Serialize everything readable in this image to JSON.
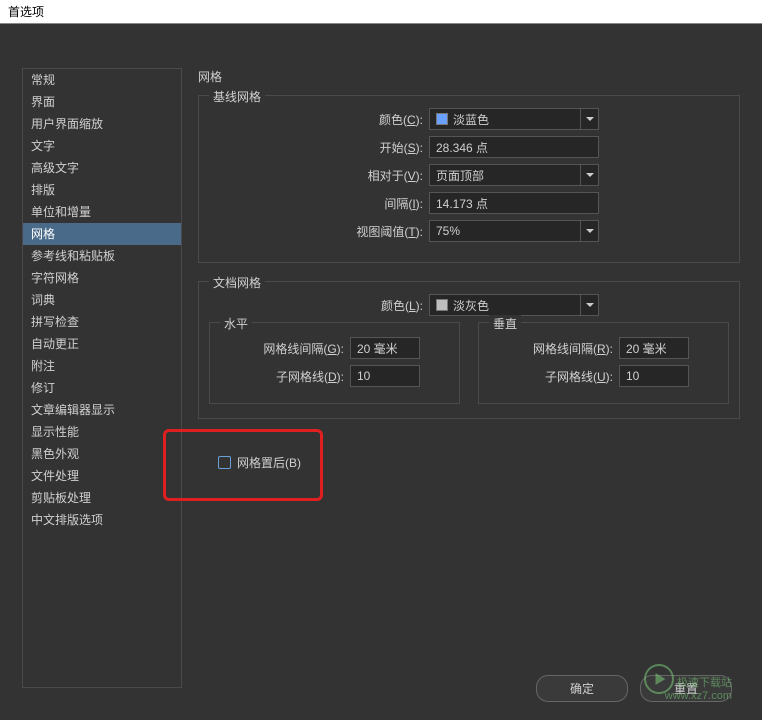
{
  "dialog": {
    "title": "首选项"
  },
  "sidebar": {
    "items": [
      {
        "label": "常规",
        "selected": false
      },
      {
        "label": "界面",
        "selected": false
      },
      {
        "label": "用户界面缩放",
        "selected": false
      },
      {
        "label": "文字",
        "selected": false
      },
      {
        "label": "高级文字",
        "selected": false
      },
      {
        "label": "排版",
        "selected": false
      },
      {
        "label": "单位和增量",
        "selected": false
      },
      {
        "label": "网格",
        "selected": true
      },
      {
        "label": "参考线和粘贴板",
        "selected": false
      },
      {
        "label": "字符网格",
        "selected": false
      },
      {
        "label": "词典",
        "selected": false
      },
      {
        "label": "拼写检查",
        "selected": false
      },
      {
        "label": "自动更正",
        "selected": false
      },
      {
        "label": "附注",
        "selected": false
      },
      {
        "label": "修订",
        "selected": false
      },
      {
        "label": "文章编辑器显示",
        "selected": false
      },
      {
        "label": "显示性能",
        "selected": false
      },
      {
        "label": "黑色外观",
        "selected": false
      },
      {
        "label": "文件处理",
        "selected": false
      },
      {
        "label": "剪贴板处理",
        "selected": false
      },
      {
        "label": "中文排版选项",
        "selected": false
      }
    ]
  },
  "panel": {
    "title": "网格",
    "baseline": {
      "legend": "基线网格",
      "color_label": "颜色(C):",
      "color_value": "淡蓝色",
      "color_swatch": "#6aa0ff",
      "start_label": "开始(S):",
      "start_value": "28.346 点",
      "relative_label": "相对于(V):",
      "relative_value": "页面顶部",
      "spacing_label": "间隔(I):",
      "spacing_value": "14.173 点",
      "threshold_label": "视图阈值(T):",
      "threshold_value": "75%"
    },
    "document": {
      "legend": "文档网格",
      "color_label": "颜色(L):",
      "color_value": "淡灰色",
      "color_swatch": "#bdbdbd",
      "horizontal": {
        "legend": "水平",
        "gridline_label": "网格线间隔(G):",
        "gridline_value": "20 毫米",
        "subdiv_label": "子网格线(D):",
        "subdiv_value": "10"
      },
      "vertical": {
        "legend": "垂直",
        "gridline_label": "网格线间隔(R):",
        "gridline_value": "20 毫米",
        "subdiv_label": "子网格线(U):",
        "subdiv_value": "10"
      }
    },
    "grids_in_back": {
      "label": "网格置后(B)",
      "checked": false
    }
  },
  "buttons": {
    "ok": "确定",
    "reset": "重置"
  },
  "watermark": {
    "site": "极速下载站",
    "url": "www.xz7.com"
  }
}
